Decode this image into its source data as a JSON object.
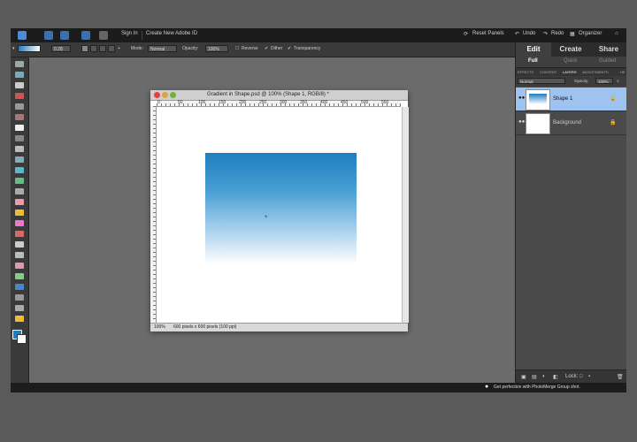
{
  "topbar": {
    "sign_in": "Sign In",
    "create_id": "Create New Adobe ID",
    "reset_panels": "Reset Panels",
    "undo": "Undo",
    "redo": "Redo",
    "organizer": "Organizer"
  },
  "options": {
    "size": "0.28",
    "mode_label": "Mode:",
    "mode_value": "Normal",
    "opacity_label": "Opacity:",
    "opacity_value": "100%",
    "reverse": "Reverse",
    "dither": "Dither",
    "transparency": "Transparency"
  },
  "document": {
    "title": "Gradient in Shape.psd @ 100% (Shape 1, RGB/8) *",
    "zoom": "100%",
    "info": "600 pixels x 600 pixels (100 ppi)",
    "ruler_marks": [
      "0",
      "50",
      "100",
      "150",
      "200",
      "250",
      "300",
      "350",
      "400",
      "450",
      "500",
      "550"
    ]
  },
  "right_panel": {
    "mode_tabs": [
      "Edit",
      "Create",
      "Share"
    ],
    "sub_tabs": [
      "Full",
      "Quick",
      "Guided"
    ],
    "panel_tabs": [
      "EFFECTS",
      "CONTENT",
      "LAYERS",
      "ADJUSTMENTS",
      "HE"
    ],
    "blend_mode": "Normal",
    "opacity_label": "Opacity:",
    "opacity_value": "100%",
    "layers": [
      "Shape 1",
      "Background"
    ],
    "lock_label": "Lock:"
  },
  "statusbar": {
    "message": "Get perfection with PhotoMerge Group shot."
  },
  "colors": {
    "gradient_top": "#1f7fc0",
    "gradient_bottom": "#ffffff",
    "selected_layer": "#9fc3f0"
  }
}
